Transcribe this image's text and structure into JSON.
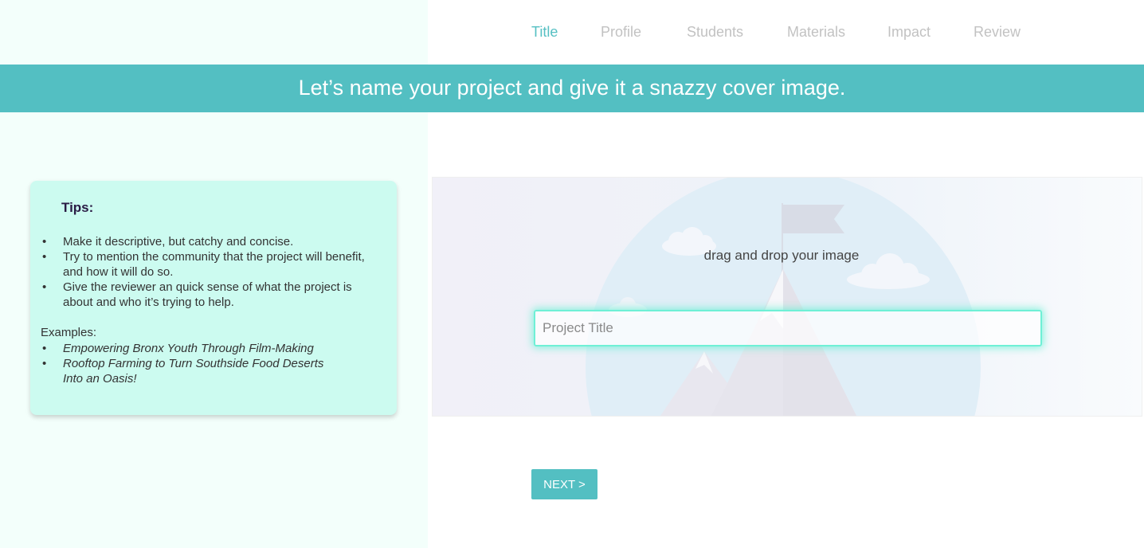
{
  "steps": [
    "Title",
    "Profile",
    "Students",
    "Materials",
    "Impact",
    "Review"
  ],
  "active_step": "Title",
  "banner": {
    "text": "Let’s name your project and give it a snazzy cover image."
  },
  "tips": {
    "title": "Tips:",
    "items": [
      "Make it descriptive, but catchy and concise.",
      "Try to mention the community that the project will benefit, and how it will do so.",
      "Give the reviewer an quick sense of what the project is about and who it’s trying to help."
    ],
    "examples_label": "Examples:",
    "examples": [
      "Empowering Bronx Youth Through Film-Making",
      "Rooftop Farming to Turn Southside Food Deserts Into an Oasis!"
    ]
  },
  "dropzone": {
    "text": "drag and drop your image",
    "title_placeholder": "Project Title",
    "title_value": ""
  },
  "next_button": {
    "label": "NEXT >"
  },
  "colors": {
    "accent": "#53bfc2",
    "tips_background": "#ccfbf0",
    "left_panel_background": "#f3fffb",
    "input_glow": "#6ff0d6",
    "inactive_step": "#c2c2c2"
  },
  "icons": [
    "mountain-flag-illustration",
    "cloud-icon"
  ]
}
